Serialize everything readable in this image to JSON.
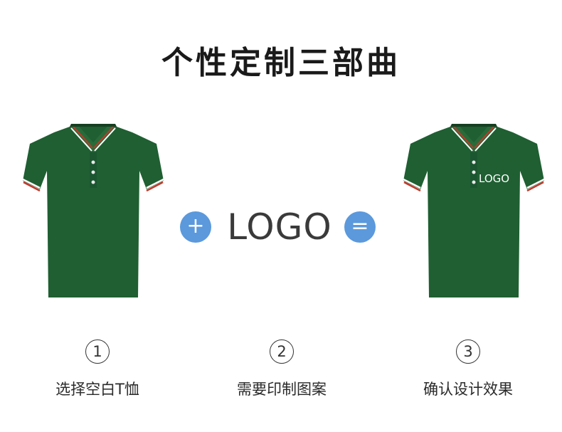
{
  "title": "个性定制三部曲",
  "shirt_color": "#1f5f32",
  "accent_color": "#5b99dc",
  "operators": {
    "plus": "+",
    "equals": "="
  },
  "logo_center_text": "LOGO",
  "logo_on_shirt_text": "LOGO",
  "steps": [
    {
      "number": "1",
      "label": "选择空白T恤"
    },
    {
      "number": "2",
      "label": "需要印制图案"
    },
    {
      "number": "3",
      "label": "确认设计效果"
    }
  ]
}
